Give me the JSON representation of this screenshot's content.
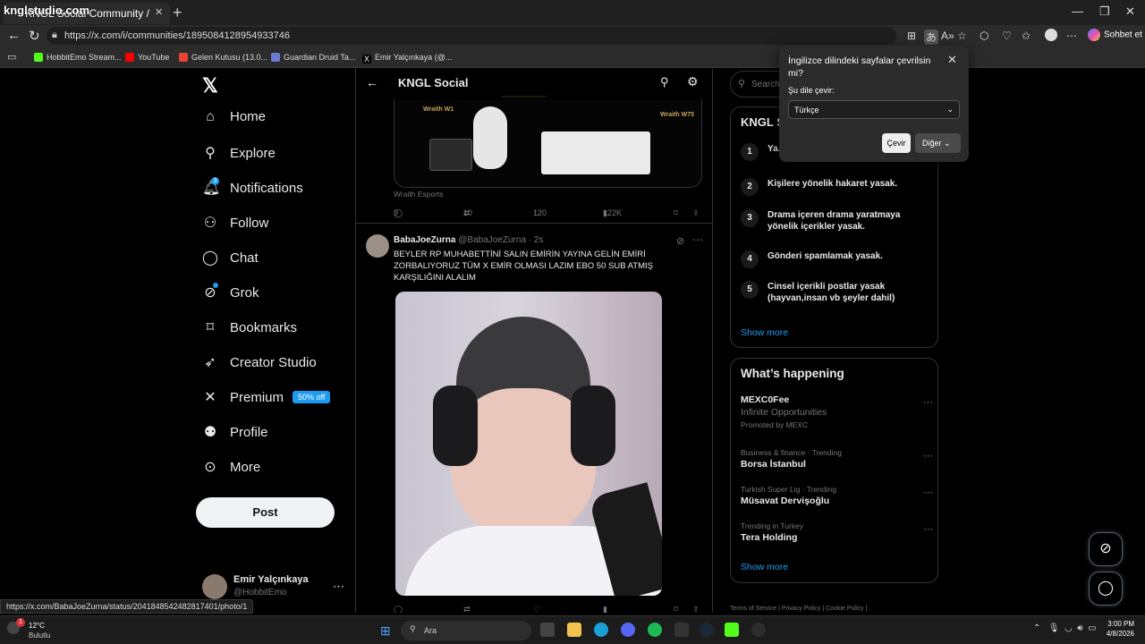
{
  "browser": {
    "tab_title": "KNGL Social Community / X",
    "watermark": "knglstudio.com",
    "url": "https://x.com/i/communities/1895084128954933746",
    "copilot_label": "Sohbet et",
    "bookmarks": [
      {
        "label": "HobbitEmo Stream...",
        "color": "#53fc18"
      },
      {
        "label": "YouTube",
        "color": "#ff0000"
      },
      {
        "label": "Gelen Kutusu (13.0...",
        "color": "#ea4335"
      },
      {
        "label": "Guardian Druid Ta...",
        "color": "#6a7bd1"
      },
      {
        "label": "Emir Yalçınkaya (@...",
        "color": "#000000"
      }
    ]
  },
  "sidebar": {
    "items": [
      {
        "label": "Home",
        "icon": "home-icon",
        "glyph": "⌂"
      },
      {
        "label": "Explore",
        "icon": "search-icon",
        "glyph": "⚲"
      },
      {
        "label": "Notifications",
        "icon": "bell-icon",
        "glyph": "🔔︎"
      },
      {
        "label": "Follow",
        "icon": "add-person-icon",
        "glyph": "⚇"
      },
      {
        "label": "Chat",
        "icon": "chat-bubble-icon",
        "glyph": "◯"
      },
      {
        "label": "Grok",
        "icon": "grok-icon",
        "glyph": "⊘"
      },
      {
        "label": "Bookmarks",
        "icon": "bookmark-icon",
        "glyph": "⌑"
      },
      {
        "label": "Creator Studio",
        "icon": "rocket-icon",
        "glyph": "➶"
      },
      {
        "label": "Premium",
        "icon": "x-logo-icon",
        "glyph": "✕"
      },
      {
        "label": "Profile",
        "icon": "person-icon",
        "glyph": "⚉"
      },
      {
        "label": "More",
        "icon": "more-circle-icon",
        "glyph": "⊙"
      }
    ],
    "notification_count": "3",
    "premium_badge": "50% off",
    "post_label": "Post",
    "account_name": "Emir Yalçınkaya",
    "account_handle": "@HobbitEmo"
  },
  "column": {
    "title": "KNGL Social",
    "ad_labels": {
      "left": "Wraith W1",
      "right": "Wraith W75"
    },
    "ad_source": "Wraith Esports",
    "ad_stats": {
      "replies": "9",
      "reposts": "10",
      "likes": "120",
      "views": "122K"
    },
    "tweet": {
      "name": "BabaJoeZurna",
      "handle": "@BabaJoeZurna",
      "time": "· 2s",
      "text": "BEYLER RP MUHABETTİNİ SALIN EMİRİN YAYINA GELİN EMİRİ ZORBALIYORUZ TÜM X EMİR OLMASI LAZIM EBO 50 SUB ATMIŞ KARŞILIĞINI ALALIM"
    }
  },
  "right": {
    "search_placeholder": "Search",
    "rules_title": "KNGL S",
    "rules": [
      {
        "n": "1",
        "text": "Ya... paylaşmamak..."
      },
      {
        "n": "2",
        "text": "Kişilere yönelik hakaret yasak."
      },
      {
        "n": "3",
        "text": "Drama içeren drama yaratmaya yönelik içerikler yasak."
      },
      {
        "n": "4",
        "text": "Gönderi spamlamak yasak."
      },
      {
        "n": "5",
        "text": "Cinsel içerikli postlar yasak (hayvan,insan vb şeyler dahil)"
      }
    ],
    "rules_show_more": "Show more",
    "happening_title": "What’s happening",
    "trends": [
      {
        "cat": "MEXC0Fee",
        "name": "Infinite Opportunities",
        "promo": "Promoted by MEXC"
      },
      {
        "cat": "Business & finance · Trending",
        "name": "Borsa İstanbul"
      },
      {
        "cat": "Turkish Super Lig · Trending",
        "name": "Müsavat Dervişoğlu"
      },
      {
        "cat": "Trending in Turkey",
        "name": "Tera Holding"
      }
    ],
    "happening_show_more": "Show more",
    "footer": "Terms of Service  |  Privacy Policy  |  Cookie Policy  |"
  },
  "translate_popup": {
    "question": "İngilizce dilindeki sayfalar çevrilsin mi?",
    "label": "Şu dile çevir:",
    "selected": "Türkçe",
    "translate_btn": "Çevir",
    "other_btn": "Diğer"
  },
  "status_url": "https://x.com/BabaJoeZurna/status/2041848542482817401/photo/1",
  "taskbar": {
    "temp": "12°C",
    "weather": "Bulutlu",
    "weather_badge": "1",
    "search": "Ara",
    "time": "3:00 PM",
    "date": "4/8/2026"
  }
}
